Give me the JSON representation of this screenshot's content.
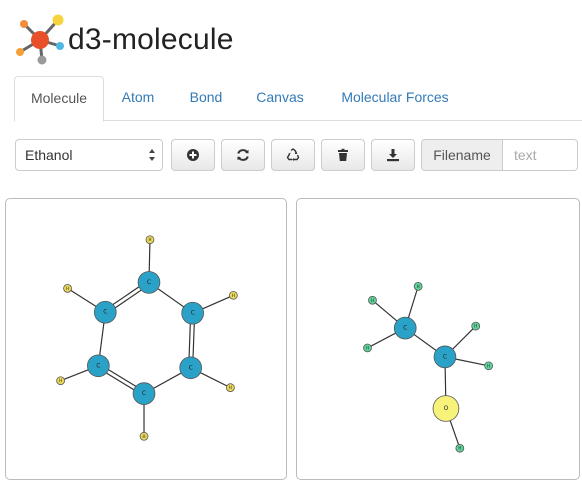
{
  "app": {
    "title": "d3-molecule"
  },
  "tabs": [
    {
      "label": "Molecule",
      "active": true
    },
    {
      "label": "Atom",
      "active": false
    },
    {
      "label": "Bond",
      "active": false
    },
    {
      "label": "Canvas",
      "active": false
    },
    {
      "label": "Molecular Forces",
      "active": false
    }
  ],
  "toolbar": {
    "molecule_select": {
      "value": "Ethanol"
    },
    "buttons": [
      {
        "name": "add-button",
        "icon": "plus-circle-icon"
      },
      {
        "name": "refresh-button",
        "icon": "refresh-icon"
      },
      {
        "name": "recycle-button",
        "icon": "recycle-icon"
      },
      {
        "name": "delete-button",
        "icon": "trash-icon"
      },
      {
        "name": "download-button",
        "icon": "download-icon"
      }
    ],
    "filename": {
      "label": "Filename",
      "placeholder": "text",
      "value": ""
    }
  },
  "colors": {
    "carbon": "#2aa2c8",
    "hydrogen_left": "#e8d85a",
    "hydrogen_right": "#5fd49a",
    "oxygen": "#f6f27a",
    "accent": "#337ab7"
  },
  "molecules": {
    "left": {
      "atoms": [
        {
          "symbol": "C"
        },
        {
          "symbol": "C"
        },
        {
          "symbol": "C"
        },
        {
          "symbol": "C"
        },
        {
          "symbol": "C"
        },
        {
          "symbol": "C"
        },
        {
          "symbol": "H"
        },
        {
          "symbol": "H"
        },
        {
          "symbol": "H"
        },
        {
          "symbol": "H"
        },
        {
          "symbol": "H"
        },
        {
          "symbol": "H"
        }
      ],
      "bonds": [
        {
          "a": 0,
          "b": 1,
          "order": 1
        },
        {
          "a": 1,
          "b": 2,
          "order": 2
        },
        {
          "a": 2,
          "b": 3,
          "order": 1
        },
        {
          "a": 3,
          "b": 4,
          "order": 2
        },
        {
          "a": 4,
          "b": 5,
          "order": 1
        },
        {
          "a": 5,
          "b": 0,
          "order": 2
        },
        {
          "a": 0,
          "b": 6,
          "order": 1
        },
        {
          "a": 1,
          "b": 7,
          "order": 1
        },
        {
          "a": 2,
          "b": 8,
          "order": 1
        },
        {
          "a": 3,
          "b": 9,
          "order": 1
        },
        {
          "a": 4,
          "b": 10,
          "order": 1
        },
        {
          "a": 5,
          "b": 11,
          "order": 1
        }
      ]
    },
    "right": {
      "atoms": [
        {
          "symbol": "C"
        },
        {
          "symbol": "C"
        },
        {
          "symbol": "O"
        },
        {
          "symbol": "H"
        },
        {
          "symbol": "H"
        },
        {
          "symbol": "H"
        },
        {
          "symbol": "H"
        },
        {
          "symbol": "H"
        },
        {
          "symbol": "H"
        }
      ],
      "bonds": [
        {
          "a": 0,
          "b": 1,
          "order": 1
        },
        {
          "a": 1,
          "b": 2,
          "order": 1
        },
        {
          "a": 0,
          "b": 3,
          "order": 1
        },
        {
          "a": 0,
          "b": 4,
          "order": 1
        },
        {
          "a": 0,
          "b": 5,
          "order": 1
        },
        {
          "a": 1,
          "b": 6,
          "order": 1
        },
        {
          "a": 1,
          "b": 7,
          "order": 1
        },
        {
          "a": 2,
          "b": 8,
          "order": 1
        }
      ]
    }
  }
}
